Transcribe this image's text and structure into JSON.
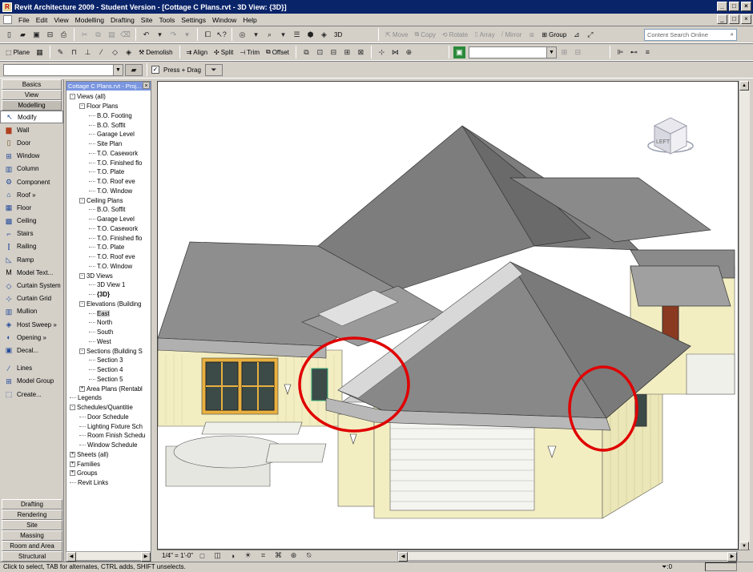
{
  "window": {
    "title": "Revit Architecture 2009 - Student Version - [Cottage C Plans.rvt - 3D View: {3D}]",
    "controls": [
      "_",
      "□",
      "×"
    ]
  },
  "menu": [
    "File",
    "Edit",
    "View",
    "Modelling",
    "Drafting",
    "Site",
    "Tools",
    "Settings",
    "Window",
    "Help"
  ],
  "toolbar1": {
    "view_label": "3D",
    "move": "Move",
    "copy": "Copy",
    "rotate": "Rotate",
    "array": "Array",
    "mirror": "Mirror",
    "group": "Group",
    "search_placeholder": "Content Search Online"
  },
  "toolbar2": {
    "plane": "Plane",
    "demolish": "Demolish",
    "align": "Align",
    "split": "Split",
    "trim": "Trim",
    "offset": "Offset"
  },
  "toolbar3": {
    "press_drag": "Press + Drag"
  },
  "design_bar": {
    "top_tabs": [
      "Basics",
      "View",
      "Modelling"
    ],
    "tools": [
      "Modify",
      "Wall",
      "Door",
      "Window",
      "Column",
      "Component",
      "Roof »",
      "Floor",
      "Ceiling",
      "Stairs",
      "Railing",
      "Ramp",
      "Model Text...",
      "Curtain System",
      "Curtain Grid",
      "Mullion",
      "Host Sweep »",
      "Opening »",
      "Decal...",
      "Lines",
      "Model Group",
      "Create..."
    ],
    "bottom_tabs": [
      "Drafting",
      "Rendering",
      "Site",
      "Massing",
      "Room and Area",
      "Structural"
    ]
  },
  "project_browser": {
    "title": "Cottage C Plans.rvt - Proj...",
    "tree": [
      {
        "label": "Views (all)",
        "level": 0,
        "toggle": "-"
      },
      {
        "label": "Floor Plans",
        "level": 1,
        "toggle": "-"
      },
      {
        "label": "B.O. Footing",
        "level": 2
      },
      {
        "label": "B.O. Soffit",
        "level": 2
      },
      {
        "label": "Garage Level",
        "level": 2
      },
      {
        "label": "Site Plan",
        "level": 2
      },
      {
        "label": "T.O. Casework",
        "level": 2
      },
      {
        "label": "T.O. Finished flo",
        "level": 2
      },
      {
        "label": "T.O. Plate",
        "level": 2
      },
      {
        "label": "T.O. Roof eve",
        "level": 2
      },
      {
        "label": "T.O. Window",
        "level": 2
      },
      {
        "label": "Ceiling Plans",
        "level": 1,
        "toggle": "-"
      },
      {
        "label": "B.O. Soffit",
        "level": 2
      },
      {
        "label": "Garage Level",
        "level": 2
      },
      {
        "label": "T.O. Casework",
        "level": 2
      },
      {
        "label": "T.O. Finished flo",
        "level": 2
      },
      {
        "label": "T.O. Plate",
        "level": 2
      },
      {
        "label": "T.O. Roof eve",
        "level": 2
      },
      {
        "label": "T.O. Window",
        "level": 2
      },
      {
        "label": "3D Views",
        "level": 1,
        "toggle": "-"
      },
      {
        "label": "3D View 1",
        "level": 2
      },
      {
        "label": "{3D}",
        "level": 2,
        "bold": true
      },
      {
        "label": "Elevations (Building",
        "level": 1,
        "toggle": "-"
      },
      {
        "label": "East",
        "level": 2,
        "selected": true
      },
      {
        "label": "North",
        "level": 2
      },
      {
        "label": "South",
        "level": 2
      },
      {
        "label": "West",
        "level": 2
      },
      {
        "label": "Sections (Building S",
        "level": 1,
        "toggle": "-"
      },
      {
        "label": "Section 3",
        "level": 2
      },
      {
        "label": "Section 4",
        "level": 2
      },
      {
        "label": "Section 5",
        "level": 2
      },
      {
        "label": "Area Plans (Rentabl",
        "level": 1,
        "toggle": "+"
      },
      {
        "label": "Legends",
        "level": 0
      },
      {
        "label": "Schedules/Quantitie",
        "level": 0,
        "toggle": "-"
      },
      {
        "label": "Door Schedule",
        "level": 1
      },
      {
        "label": "Lighting Fixture Sch",
        "level": 1
      },
      {
        "label": "Room Finish Schedu",
        "level": 1
      },
      {
        "label": "Window Schedule",
        "level": 1
      },
      {
        "label": "Sheets (all)",
        "level": 0,
        "toggle": "+"
      },
      {
        "label": "Families",
        "level": 0,
        "toggle": "+"
      },
      {
        "label": "Groups",
        "level": 0,
        "toggle": "+"
      },
      {
        "label": "Revit Links",
        "level": 0
      }
    ]
  },
  "viewcube": {
    "face": "LEFT"
  },
  "view_control": {
    "scale": "1/4\" = 1'-0\""
  },
  "status": {
    "message": "Click to select, TAB for alternates, CTRL adds, SHIFT unselects.",
    "filter_count": "0"
  },
  "colors": {
    "titlebar": "#0a246a",
    "roof": "#7a7a7a",
    "siding": "#f3eec2",
    "annotation": "#e00000"
  }
}
